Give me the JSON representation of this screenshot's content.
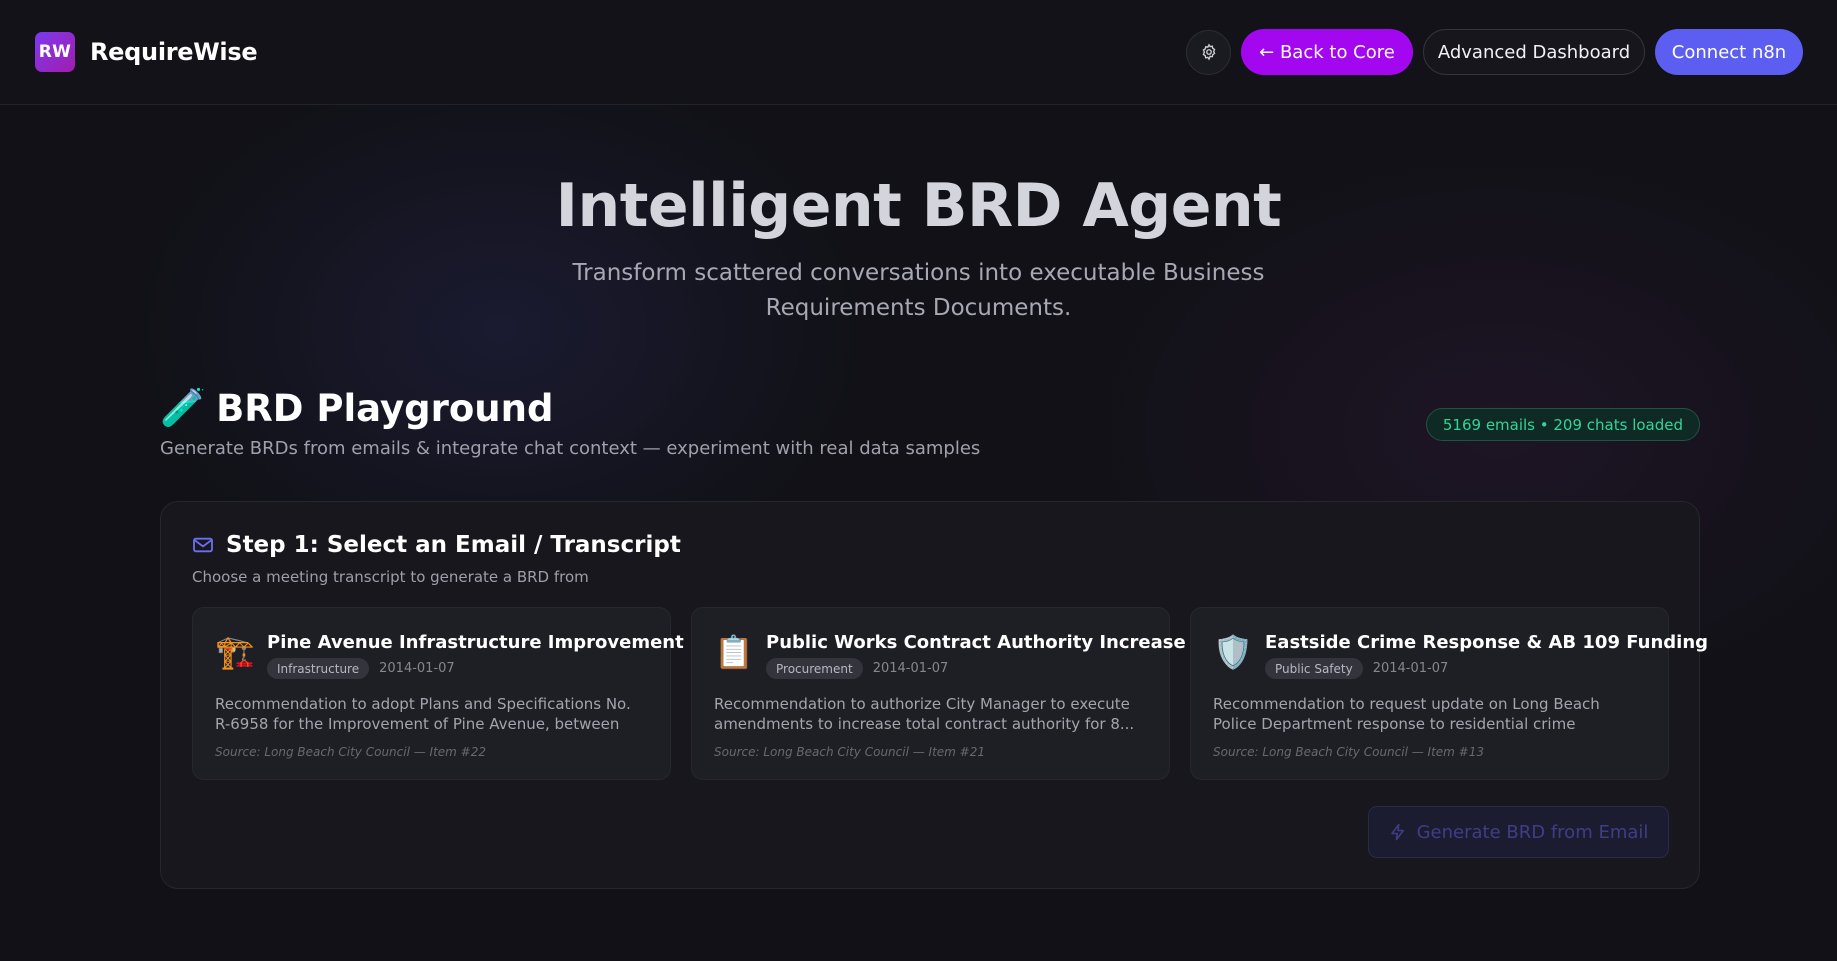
{
  "header": {
    "logo_text": "RW",
    "brand_name": "RequireWise",
    "settings_icon": "gear-icon",
    "back_label": "← Back to Core",
    "advanced_label": "Advanced Dashboard",
    "connect_label": "Connect n8n"
  },
  "hero": {
    "title": "Intelligent BRD Agent",
    "subtitle": "Transform scattered conversations into executable Business Requirements Documents."
  },
  "playground": {
    "emoji": "🧪",
    "title": "BRD Playground",
    "subtitle": "Generate BRDs from emails & integrate chat context — experiment with real data samples",
    "loaded_badge": "5169 emails • 209 chats loaded"
  },
  "step1": {
    "icon": "mail-icon",
    "title": "Step 1: Select an Email / Transcript",
    "subtitle": "Choose a meeting transcript to generate a BRD from",
    "cards": [
      {
        "emoji": "🏗️",
        "title": "Pine Avenue Infrastructure Improvement",
        "tag": "Infrastructure",
        "date": "2014-01-07",
        "description": "Recommendation to adopt Plans and Specifications No. R-6958 for the Improvement of Pine Avenue, between Seasid...",
        "source": "Source: Long Beach City Council — Item #22"
      },
      {
        "emoji": "📋",
        "title": "Public Works Contract Authority Increase",
        "tag": "Procurement",
        "date": "2014-01-07",
        "description": "Recommendation to authorize City Manager to execute amendments to increase total contract authority for 8...",
        "source": "Source: Long Beach City Council — Item #21"
      },
      {
        "emoji": "🛡️",
        "title": "Eastside Crime Response & AB 109 Funding",
        "tag": "Public Safety",
        "date": "2014-01-07",
        "description": "Recommendation to request update on Long Beach Police Department response to residential crime increases in...",
        "source": "Source: Long Beach City Council — Item #13"
      }
    ],
    "generate_icon": "lightning-icon",
    "generate_label": "Generate BRD from Email"
  },
  "colors": {
    "accent_purple": "#a207f0",
    "accent_indigo": "#5b5ef0",
    "success_green": "#34d399"
  }
}
